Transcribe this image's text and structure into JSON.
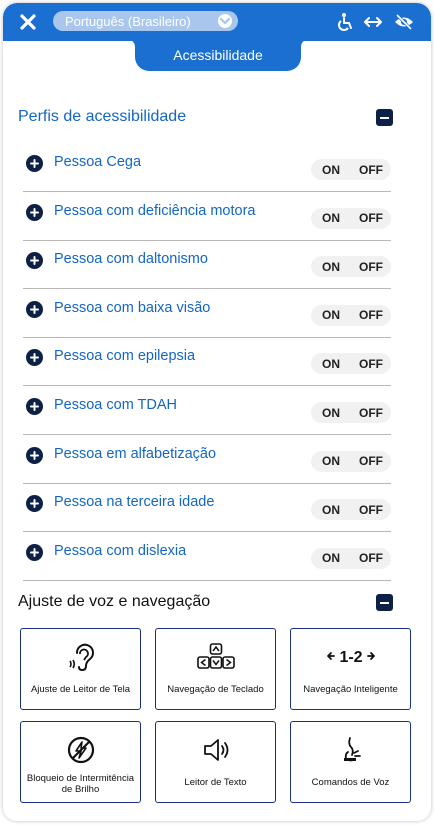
{
  "header": {
    "language": "Português (Brasileiro)",
    "tab_label": "Acessibilidade"
  },
  "profiles": {
    "title": "Perfis de acessibilidade",
    "on_label": "ON",
    "off_label": "OFF",
    "items": [
      {
        "label": "Pessoa Cega"
      },
      {
        "label": "Pessoa com deficiência motora"
      },
      {
        "label": "Pessoa com daltonismo"
      },
      {
        "label": "Pessoa com baixa visão"
      },
      {
        "label": "Pessoa com epilepsia"
      },
      {
        "label": "Pessoa com TDAH"
      },
      {
        "label": "Pessoa em alfabetização"
      },
      {
        "label": "Pessoa na terceira idade"
      },
      {
        "label": "Pessoa com dislexia"
      }
    ]
  },
  "voice_nav": {
    "title": "Ajuste de voz e navegação",
    "tiles": [
      {
        "label": "Ajuste de Leitor de Tela",
        "icon": "ear-icon"
      },
      {
        "label": "Navegação de Teclado",
        "icon": "keyboard-icon"
      },
      {
        "label": "Navegação Inteligente",
        "icon": "smart-nav-icon",
        "glyph": "1-2"
      },
      {
        "label": "Bloqueio de Intermitência de Brilho",
        "icon": "flash-off-icon"
      },
      {
        "label": "Leitor de Texto",
        "icon": "speaker-icon"
      },
      {
        "label": "Comandos de Voz",
        "icon": "voice-command-icon"
      }
    ]
  },
  "colors": {
    "primary": "#1a6fd1",
    "dark": "#0d2147",
    "profile_text": "#1366c7"
  }
}
